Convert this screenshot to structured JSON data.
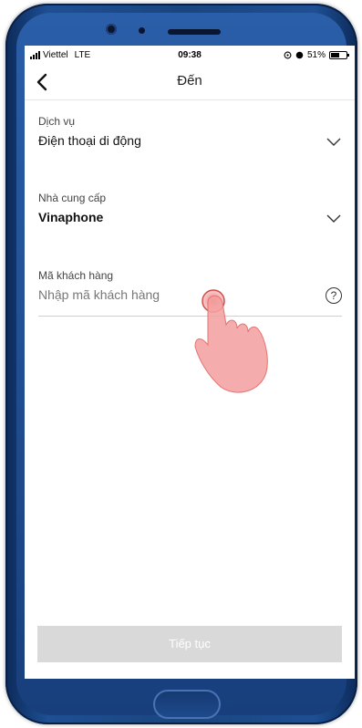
{
  "status_bar": {
    "carrier": "Viettel",
    "network": "LTE",
    "time": "09:38",
    "battery": "51%"
  },
  "header": {
    "title": "Đến"
  },
  "form": {
    "service": {
      "label": "Dịch vụ",
      "value": "Điện thoại di động"
    },
    "provider": {
      "label": "Nhà cung cấp",
      "value": "Vinaphone"
    },
    "customer_code": {
      "label": "Mã khách hàng",
      "placeholder": "Nhập mã khách hàng",
      "help_icon": "?"
    }
  },
  "continue_button": {
    "label": "Tiếp tục"
  },
  "colors": {
    "phone_frame": "#1a467f",
    "button_disabled": "#d9d9d9",
    "tap_hand": "#f08080"
  },
  "icons": [
    "back-arrow-icon",
    "chevron-down-icon",
    "help-icon",
    "tap-hand-icon"
  ]
}
